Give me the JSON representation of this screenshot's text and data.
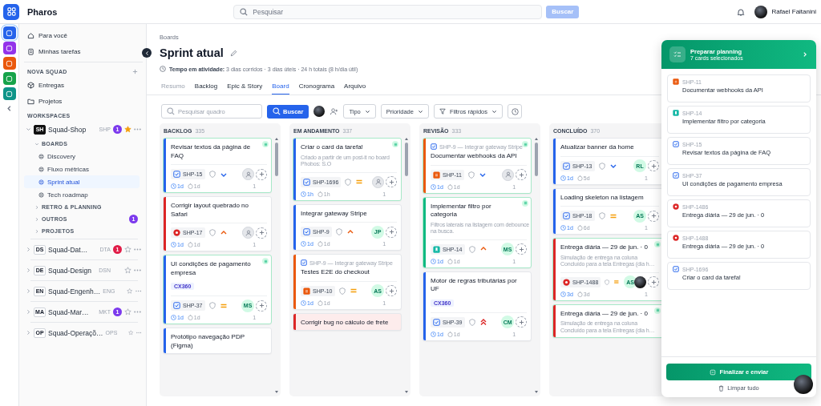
{
  "topbar": {
    "app_name": "Pharos",
    "search": {
      "placeholder": "Pesquisar"
    },
    "search_button": {
      "label": "Buscar",
      "disabled": true
    },
    "user": {
      "name": "Rafael Faitanini"
    }
  },
  "rail": [
    {
      "color": "#2563eb",
      "selected": true
    },
    {
      "color": "#9333ea",
      "selected": false
    },
    {
      "color": "#ea580c",
      "selected": false
    },
    {
      "color": "#16a34a",
      "selected": false
    },
    {
      "color": "#0d9488",
      "selected": false
    }
  ],
  "sidebar": {
    "top_items": [
      {
        "label": "Para você",
        "kind": "home"
      },
      {
        "label": "Minhas tarefas",
        "kind": "tasks"
      }
    ],
    "squad_section": "NOVA SQUAD",
    "squad_items": [
      {
        "label": "Entregas",
        "kind": "box"
      },
      {
        "label": "Projetos",
        "kind": "folder"
      }
    ],
    "workspaces_label": "WORKSPACES",
    "workspaces": [
      {
        "badge": "SH",
        "name": "Squad-Shop",
        "code": "SHP",
        "count": "1",
        "color": "#7c3aed",
        "starred": true,
        "expanded": true,
        "groups": [
          {
            "label": "BOARDS",
            "expanded": true,
            "items": [
              {
                "label": "Discovery",
                "selected": false
              },
              {
                "label": "Fluxo métricas",
                "selected": false
              },
              {
                "label": "Sprint atual",
                "selected": true
              },
              {
                "label": "Tech roadmap",
                "selected": false
              }
            ]
          },
          {
            "label": "RETRO & PLANNING",
            "expanded": false
          },
          {
            "label": "OUTROS",
            "expanded": false,
            "count": "1"
          },
          {
            "label": "PROJETOS",
            "expanded": false
          }
        ]
      },
      {
        "badge": "DS",
        "name": "Squad-Dat…",
        "code": "DTA",
        "count": "1",
        "color": "#e11d48",
        "starred": false,
        "expanded": false
      },
      {
        "badge": "DE",
        "name": "Squad-Design",
        "code": "DSN",
        "starred": false,
        "expanded": false
      },
      {
        "badge": "EN",
        "name": "Squad-Engenh…",
        "code": "ENG",
        "starred": false,
        "expanded": false
      },
      {
        "badge": "MA",
        "name": "Squad-Mar…",
        "code": "MKT",
        "count": "1",
        "color": "#7c3aed",
        "starred": false,
        "expanded": false
      },
      {
        "badge": "OP",
        "name": "Squad-Operaçõ…",
        "code": "OPS",
        "starred": false,
        "expanded": false
      }
    ]
  },
  "header": {
    "breadcrumb": "Boards",
    "title": "Sprint atual",
    "activity": "**Tempo em atividade:** 3 dias corridos · 3 dias úteis · 24 h totais (8 h/dia útil)"
  },
  "tabs": [
    {
      "label": "Resumo",
      "selected": false,
      "disabled": true
    },
    {
      "label": "Backlog",
      "selected": false,
      "disabled": false
    },
    {
      "label": "Epic & Story",
      "selected": false,
      "disabled": false
    },
    {
      "label": "Board",
      "selected": true,
      "disabled": false
    },
    {
      "label": "Cronograma",
      "selected": false,
      "disabled": false
    },
    {
      "label": "Arquivo",
      "selected": false,
      "disabled": false
    }
  ],
  "toolbar": {
    "search": {
      "placeholder": "Pesquisar quadro"
    },
    "search_button": "Buscar",
    "filters": [
      {
        "label": "Tipo",
        "kind": "plain"
      },
      {
        "label": "Prioridade",
        "kind": "plain"
      },
      {
        "label": "Filtros rápidos",
        "kind": "funnel"
      }
    ]
  },
  "columns": [
    {
      "name": "BACKLOG",
      "count": "335",
      "cards": [
        {
          "title": "Revisar textos da página de FAQ",
          "kind": "task",
          "key": "SHP-15",
          "priority": {
            "kind": "low"
          },
          "time": "1d",
          "estimate": "1d",
          "count": "1",
          "color": "#2563eb",
          "selected": true,
          "flagged": false
        },
        {
          "title": "Corrigir layout quebrado no Safari",
          "kind": "bug",
          "key": "SHP-17",
          "priority": {
            "kind": "high"
          },
          "time": "1d",
          "estimate": "1d",
          "count": "1",
          "color": "#dc2626",
          "selected": false,
          "flagged": false
        },
        {
          "title": "UI condições de pagamento empresa",
          "tag": "CX360",
          "kind": "task",
          "key": "SHP-37",
          "priority": {
            "kind": "medium"
          },
          "assignees": [
            {
              "kind": "initials",
              "initials": "MS"
            }
          ],
          "time": "1d",
          "estimate": "1d",
          "count": "1",
          "color": "#2563eb",
          "selected": true,
          "flagged": false
        },
        {
          "title": "Protótipo navegação PDP (Figma)",
          "color": "#2563eb",
          "selected": false,
          "flagged": false
        }
      ]
    },
    {
      "name": "EM ANDAMENTO",
      "count": "337",
      "cards": [
        {
          "title": "Criar o card da tarefa!",
          "description": "Criado a partir de um post-it no board Phobos: S.O",
          "kind": "task",
          "key": "SHP-1696",
          "priority": {
            "kind": "medium"
          },
          "time": "1h",
          "estimate": "1h",
          "count": "1",
          "color": "#2563eb",
          "selected": true,
          "flagged": false
        },
        {
          "title": "Integrar gateway Stripe",
          "kind": "task",
          "key": "SHP-9",
          "priority": {
            "kind": "high"
          },
          "assignees": [
            {
              "kind": "initials",
              "initials": "JP"
            }
          ],
          "time": "1d",
          "estimate": "1d",
          "count": "1",
          "color": "#2563eb",
          "selected": false,
          "flagged": false
        },
        {
          "parent": "SHP-9 — Integrar gateway Stripe",
          "title": "Testes E2E do checkout",
          "kind": "subtask",
          "key": "SHP-10",
          "priority": {
            "kind": "medium"
          },
          "assignees": [
            {
              "kind": "initials",
              "initials": "AS"
            }
          ],
          "time": "1d",
          "estimate": "1d",
          "count": "1",
          "color": "#ea580c",
          "selected": false,
          "flagged": false
        },
        {
          "title": "Corrigir bug no cálculo de frete",
          "color": "#dc2626",
          "selected": false,
          "flagged": true
        }
      ]
    },
    {
      "name": "REVISÃO",
      "count": "333",
      "cards": [
        {
          "parent": "SHP-9 — Integrar gateway Stripe",
          "title": "Documentar webhooks da API",
          "kind": "subtask",
          "key": "SHP-11",
          "priority": {
            "kind": "low"
          },
          "time": "1d",
          "estimate": "1d",
          "count": "1",
          "color": "#ea580c",
          "selected": true,
          "flagged": false
        },
        {
          "title": "Implementar filtro por categoria",
          "description": "Filtros laterais na listagem com debounce na busca.",
          "kind": "story",
          "key": "SHP-14",
          "priority": {
            "kind": "high"
          },
          "assignees": [
            {
              "kind": "initials",
              "initials": "MS"
            }
          ],
          "time": "1d",
          "estimate": "1d",
          "count": "1",
          "color": "#10b981",
          "selected": true,
          "flagged": false
        },
        {
          "title": "Motor de regras tributárias por UF",
          "tag": "CX360",
          "kind": "task",
          "key": "SHP-39",
          "priority": {
            "kind": "highest"
          },
          "assignees": [
            {
              "kind": "initials",
              "initials": "CM"
            }
          ],
          "time": "1d",
          "estimate": "1d",
          "count": "1",
          "color": "#2563eb",
          "selected": false,
          "flagged": false
        }
      ]
    },
    {
      "name": "CONCLUÍDO",
      "count": "370",
      "cards": [
        {
          "title": "Atualizar banner da home",
          "kind": "task",
          "key": "SHP-13",
          "priority": {
            "kind": "low"
          },
          "assignees": [
            {
              "kind": "initials",
              "initials": "RL"
            }
          ],
          "time": "1d",
          "estimate": "5d",
          "count": "1",
          "color": "#2563eb",
          "selected": false,
          "flagged": false
        },
        {
          "title": "Loading skeleton na listagem",
          "kind": "task",
          "key": "SHP-18",
          "priority": {
            "kind": "medium"
          },
          "assignees": [
            {
              "kind": "initials",
              "initials": "AS"
            }
          ],
          "time": "1d",
          "estimate": "6d",
          "count": "1",
          "color": "#2563eb",
          "selected": false,
          "flagged": false
        },
        {
          "title": "Entrega diária — 29 de jun. · 0",
          "description": "Simulação de entrega na coluna Concluído para a tela Entregas (dia h…",
          "kind": "bug",
          "key": "SHP-1488",
          "priority": {
            "kind": "medium"
          },
          "assignees": [
            {
              "kind": "initials",
              "initials": "AS"
            },
            {
              "kind": "photo"
            }
          ],
          "time": "3d",
          "estimate": "3d",
          "count": "1",
          "color": "#dc2626",
          "selected": true,
          "flagged": false
        },
        {
          "title": "Entrega diária — 29 de jun. · 0",
          "description": "Simulação de entrega na coluna Concluído para a tela Entregas (dia h…",
          "color": "#dc2626",
          "selected": true,
          "flagged": false
        }
      ]
    }
  ],
  "planning": {
    "title": "Preparar planning",
    "subtitle": "7 cards selecionados",
    "items": [
      {
        "kind": "subtask",
        "key": "SHP-11",
        "title": "Documentar webhooks da API"
      },
      {
        "kind": "story",
        "key": "SHP-14",
        "title": "Implementar filtro por categoria"
      },
      {
        "kind": "task",
        "key": "SHP-15",
        "title": "Revisar textos da página de FAQ"
      },
      {
        "kind": "task",
        "key": "SHP-37",
        "title": "UI condições de pagamento empresa"
      },
      {
        "kind": "bug",
        "key": "SHP-1486",
        "title": "Entrega diária — 29 de jun. · 0"
      },
      {
        "kind": "bug",
        "key": "SHP-1488",
        "title": "Entrega diária — 29 de jun. · 0"
      },
      {
        "kind": "task",
        "key": "SHP-1696",
        "title": "Criar o card da tarefa!"
      }
    ],
    "submit": "Finalizar e enviar",
    "clear": "Limpar tudo"
  }
}
